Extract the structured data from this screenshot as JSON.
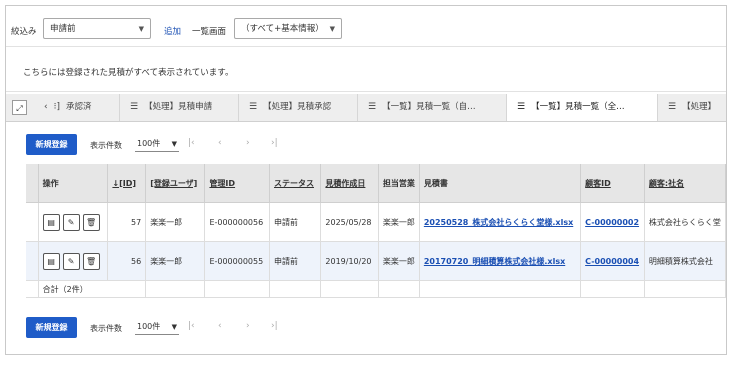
{
  "filter": {
    "label": "絞込み",
    "select_value": "申請前",
    "add_link": "追加",
    "view_label": "一覧画面",
    "view_value": "（すべて+基本情報）"
  },
  "notice": "こちらには登録された見積がすべて表示されています。",
  "tabs": [
    {
      "label": "承認済",
      "icon": "chevron-left-icon"
    },
    {
      "label": "【処理】見積申請",
      "icon": "list-icon"
    },
    {
      "label": "【処理】見積承認",
      "icon": "list-icon"
    },
    {
      "label": "【一覧】見積一覧（自…",
      "icon": "list-icon"
    },
    {
      "label": "【一覧】見積一覧（全…",
      "icon": "list-icon"
    },
    {
      "label": "【処理】",
      "icon": "list-icon"
    }
  ],
  "pager": {
    "new_button": "新規登録",
    "count_label": "表示件数",
    "count_value": "100件"
  },
  "table": {
    "headers": [
      "操作",
      "↓[ID]",
      "[登録ユーザ]",
      "管理ID",
      "ステータス",
      "見積作成日",
      "担当営業",
      "見積書",
      "顧客ID",
      "顧客:社名"
    ],
    "rows": [
      {
        "id": "57",
        "user": "楽楽一郎",
        "mgmt_id": "E-000000056",
        "status": "申請前",
        "date": "2025/05/28",
        "sales": "楽楽一郎",
        "file": "20250528_株式会社らくらく堂様.xlsx",
        "customer_id": "C-00000002",
        "company": "株式会社らくらく堂"
      },
      {
        "id": "56",
        "user": "楽楽一郎",
        "mgmt_id": "E-000000055",
        "status": "申請前",
        "date": "2019/10/20",
        "sales": "楽楽一郎",
        "file": "20170720_明細積算株式会社様.xlsx",
        "customer_id": "C-00000004",
        "company": "明細積算株式会社"
      }
    ],
    "total": "合計（2件）"
  }
}
